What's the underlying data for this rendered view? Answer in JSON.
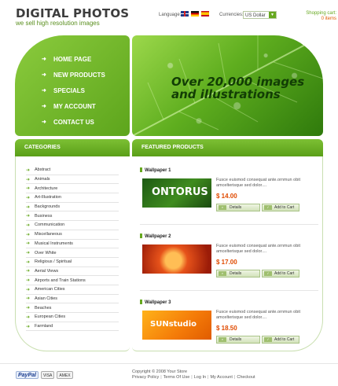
{
  "header": {
    "brand_title": "DIGITAL PHOTOS",
    "brand_tagline": "we sell high resolution images",
    "language_label": "Language:",
    "currencies_label": "Currencies:",
    "currency_selected": "US Dollar",
    "cart_label": "Shopping cart:",
    "cart_items": "0 items"
  },
  "nav": {
    "items": [
      {
        "label": "Home page"
      },
      {
        "label": "New products"
      },
      {
        "label": "Specials"
      },
      {
        "label": "My account"
      },
      {
        "label": "Contact us"
      }
    ]
  },
  "hero": {
    "line1": "Over 20,000 images",
    "line2": "and illustrations"
  },
  "categories": {
    "title": "CATEGORIES",
    "items": [
      "Abstract",
      "Animals",
      "Architecture",
      "Art-Illustration",
      "Backgrounds",
      "Business",
      "Communication",
      "Miscellaneous",
      "Musical Instruments",
      "Over White",
      "Religious / Spiritual",
      "Aerial Views",
      "Airports and Train Stations",
      "American Cities",
      "Asian Cities",
      "Beaches",
      "European Cities",
      "Farmland"
    ]
  },
  "featured": {
    "title": "FEATURED PRODUCTS",
    "details_label": "Details",
    "add_label": "Add to Cart",
    "products": [
      {
        "name": "Wallpaper 1",
        "desc": "Fusce euismod consequat ante.ornmun obit amcelterisque sed dolor....",
        "price": "$ 14.00",
        "thumb_text": "ONTORUS"
      },
      {
        "name": "Wallpaper 2",
        "desc": "Fusce euismod consequat ante.ornmun obit amcelterisque sed dolor....",
        "price": "$ 17.00",
        "thumb_text": ""
      },
      {
        "name": "Wallpaper 3",
        "desc": "Fusce euismod consequat ante.ornmun obit amcelterisque sed dolor....",
        "price": "$ 18.50",
        "thumb_text": "SUNstudio"
      }
    ]
  },
  "footer": {
    "copyright": "Copyright © 2008 Your Store",
    "links": [
      "Privacy Policy",
      "Terms Of Use",
      "Log In",
      "My Account",
      "Checkout"
    ],
    "payments": [
      "PayPal",
      "VISA",
      "AMEX"
    ]
  },
  "colors": {
    "accent_green": "#66a81f",
    "price_orange": "#e04a00"
  }
}
